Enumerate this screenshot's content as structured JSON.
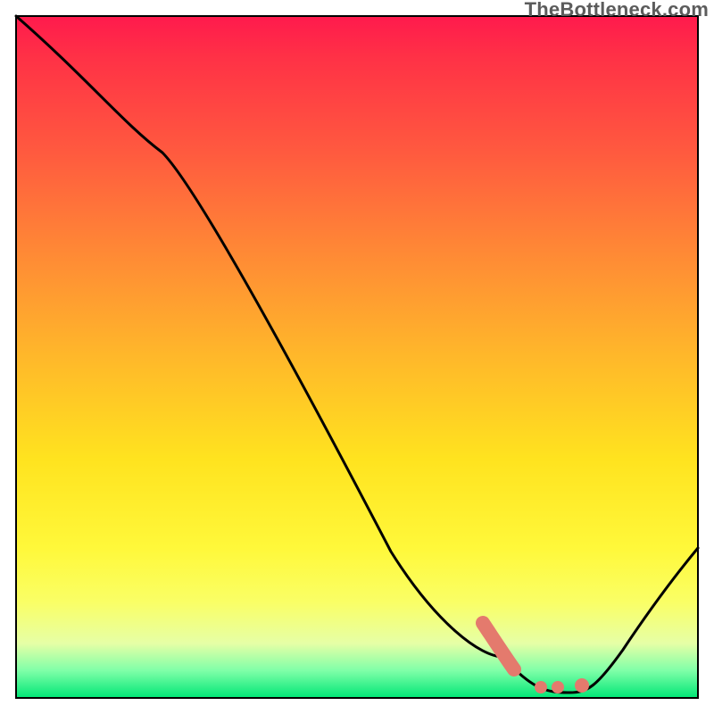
{
  "credit": "TheBottleneck.com",
  "colors": {
    "frame": "#000000",
    "curve": "#000000",
    "marker": "#e47a6d",
    "gradient_stops": [
      "#ff1a4d",
      "#ff3146",
      "#ff5a3f",
      "#ff8a35",
      "#ffb82a",
      "#ffe31f",
      "#fff83a",
      "#faff66",
      "#e6ffa6",
      "#7fffa8",
      "#00e676"
    ]
  },
  "chart_data": {
    "type": "line",
    "title": "",
    "xlabel": "",
    "ylabel": "",
    "xlim": [
      0,
      100
    ],
    "ylim": [
      0,
      100
    ],
    "series": [
      {
        "name": "bottleneck-curve",
        "x": [
          0,
          21.5,
          71.5,
          76,
          81,
          84,
          100
        ],
        "values": [
          100,
          80,
          6,
          0.5,
          0.5,
          1,
          22
        ]
      }
    ],
    "markers": [
      {
        "name": "highlight-segment",
        "shape": "thick-line",
        "points": [
          {
            "x": 68.5,
            "y": 11
          },
          {
            "x": 73,
            "y": 3.5
          }
        ]
      },
      {
        "name": "dot-1",
        "shape": "dot",
        "x": 77,
        "y": 1.2
      },
      {
        "name": "dot-2",
        "shape": "dot",
        "x": 79.5,
        "y": 1.2
      },
      {
        "name": "dot-3",
        "shape": "dot",
        "x": 83,
        "y": 1.2
      }
    ]
  }
}
